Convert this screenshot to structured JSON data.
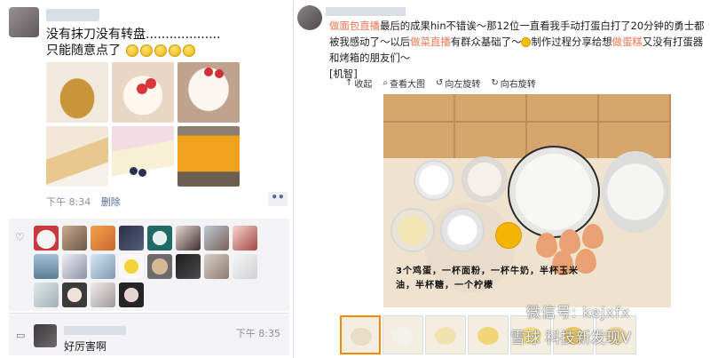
{
  "left_post": {
    "text_line1": "没有抹刀没有转盘...................",
    "text_line2": "只能随意点了",
    "time": "下午 8:34",
    "delete_label": "删除",
    "more_label": "••",
    "comment": {
      "text": "好厉害啊",
      "time": "下午 8:35"
    }
  },
  "right_post": {
    "text_a": "最后的成果hin不错诶～那12位一直看我手动打蛋白打了20分钟的勇士都被我感动了～以后",
    "tag_1": "做面包",
    "tag_2": "直播",
    "tag_3": "做菜",
    "tag_4": "直播",
    "text_b": "有群众基础了～",
    "text_c": "制作过程分享给想",
    "tag_5": "做蛋糕",
    "text_d": "又没有打蛋器和烤箱的朋友们～",
    "text_e": "[机智]",
    "toolbar": {
      "collapse": "收起",
      "view_large": "查看大图",
      "rotate_left": "向左旋转",
      "rotate_right": "向右旋转"
    },
    "recipe_text": "3个鸡蛋，一杯面粉，一杯牛奶，半杯玉米油，半杯糖，一个柠檬",
    "watermark_1": "微信号: kejxfx",
    "watermark_2": "雪球 科技新发现V"
  },
  "colors": {
    "link_blue": "#576b95",
    "tag_orange": "#eb7350",
    "meta_gray": "#8a8f99"
  }
}
